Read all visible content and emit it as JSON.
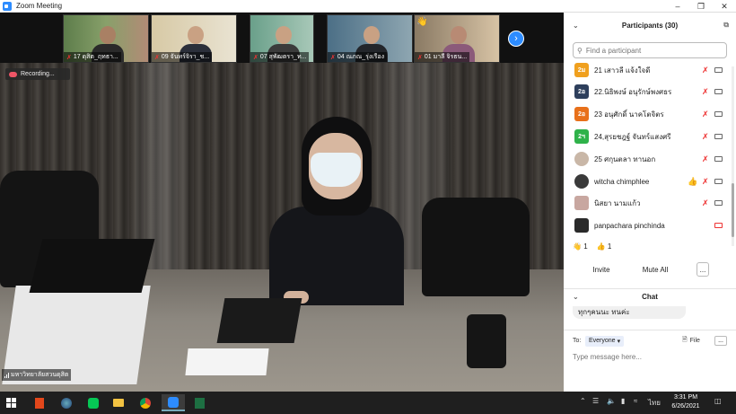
{
  "window": {
    "title": "Zoom Meeting"
  },
  "thumbnails": [
    {
      "label": "17 ดุสิต_ฤทธา..."
    },
    {
      "label": "09 จันทร์จิรา_ช..."
    },
    {
      "label": "07 สุพัฒตรา_ท..."
    },
    {
      "label": "04 ณภณ_รุ่งเรือง"
    },
    {
      "label": "01 มาลี จิรธน..."
    }
  ],
  "recording_label": "Recording...",
  "speaker_label": "มหาวิทยาลัยสวนดุสิต",
  "participants": {
    "title": "Participants (30)",
    "search_placeholder": "Find a participant",
    "list": [
      {
        "avatar": "2ม",
        "name": "21 เสาวลี แจ้งใจดี",
        "color": "#f0a01e"
      },
      {
        "avatar": "2อ",
        "name": "22.นิธิพงษ์ อนุรักษ์พงศธร",
        "color": "#2e3f5c"
      },
      {
        "avatar": "2อ",
        "name": "23 อนุศักดิ์ นาคโตจิตร",
        "color": "#e8701a"
      },
      {
        "avatar": "2ฯ",
        "name": "24,สุรยชฎฐ์ จันทร์แสงศรี",
        "color": "#2fb24a"
      },
      {
        "avatar": "",
        "name": "25 ศกุนตลา ทานอก",
        "color": "#c9b7a7"
      },
      {
        "avatar": "",
        "name": "witcha chimphlee",
        "color": "#3a3a3a"
      },
      {
        "avatar": "",
        "name": "นิสยา นามแก้ว",
        "color": "#c8a7a0"
      },
      {
        "avatar": "",
        "name": "panpachara pinchinda",
        "color": "#2a2a2a"
      }
    ],
    "reactions": [
      {
        "count": "1"
      },
      {
        "count": "1"
      }
    ],
    "invite_label": "Invite",
    "mute_all_label": "Mute All",
    "more_label": "..."
  },
  "chat": {
    "title": "Chat",
    "last_message": "ทุกๆคนนะ ทนค่ะ",
    "to_label": "To:",
    "recipient": "Everyone",
    "file_label": "File",
    "more_label": "...",
    "input_placeholder": "Type message here..."
  },
  "taskbar": {
    "time": "3:31 PM",
    "date": "6/26/2021",
    "language": "ไทย"
  }
}
